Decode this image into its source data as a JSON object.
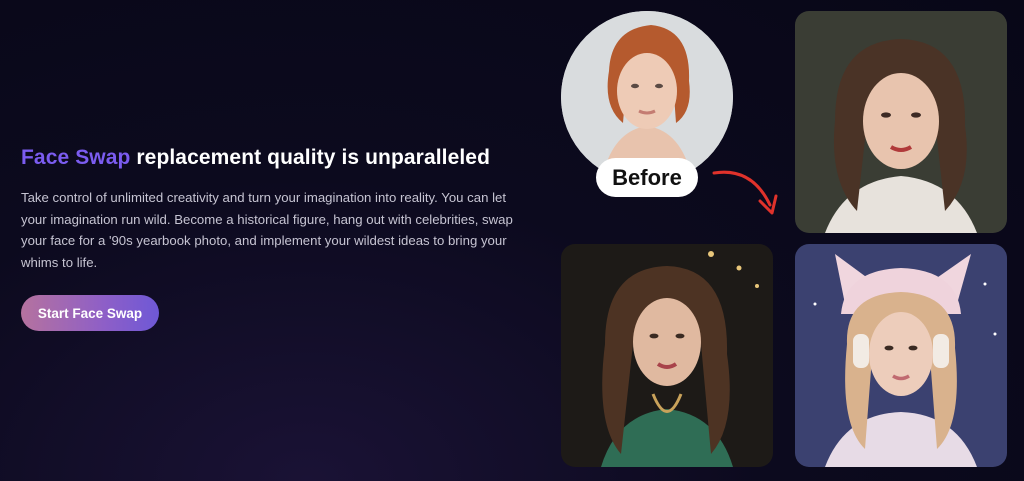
{
  "hero": {
    "headline_accent": "Face Swap",
    "headline_rest": " replacement quality is unparalleled",
    "description": "Take control of unlimited creativity and turn your imagination into reality. You can let your imagination run wild. Become a historical figure, hang out with celebrities, swap your face for a '90s yearbook photo, and implement your wildest ideas to bring your whims to life.",
    "cta_label": "Start Face Swap"
  },
  "gallery": {
    "before_label": "Before",
    "arrow_icon": "curved-arrow-icon"
  },
  "colors": {
    "accent": "#7b5cf0",
    "arrow": "#e0322b",
    "button_start": "#b5729f",
    "button_end": "#6e58d6"
  }
}
